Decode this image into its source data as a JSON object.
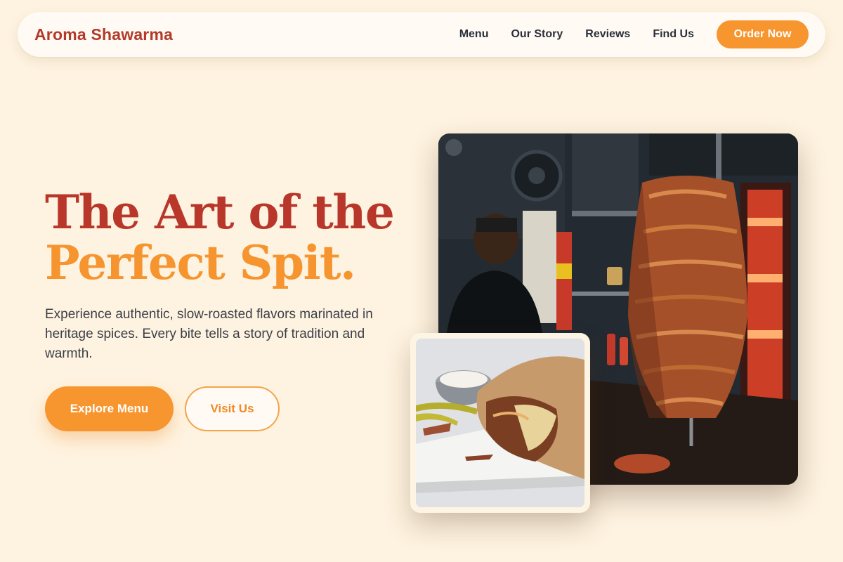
{
  "nav": {
    "brand": "Aroma Shawarma",
    "links": [
      "Menu",
      "Our Story",
      "Reviews",
      "Find Us"
    ],
    "cta": "Order Now"
  },
  "hero": {
    "headline_line1": "The Art of the",
    "headline_line2": "Perfect Spit.",
    "subtitle": "Experience authentic, slow-roasted flavors marinated in heritage spices. Every bite tells a story of tradition and warmth.",
    "primary_button": "Explore Menu",
    "secondary_button": "Visit Us"
  },
  "images": {
    "main": "shawarma-spit-photo",
    "inset": "shawarma-wrap-photo"
  },
  "colors": {
    "background": "#fef3e0",
    "brand_red": "#b8372a",
    "accent_orange": "#f7952f"
  }
}
